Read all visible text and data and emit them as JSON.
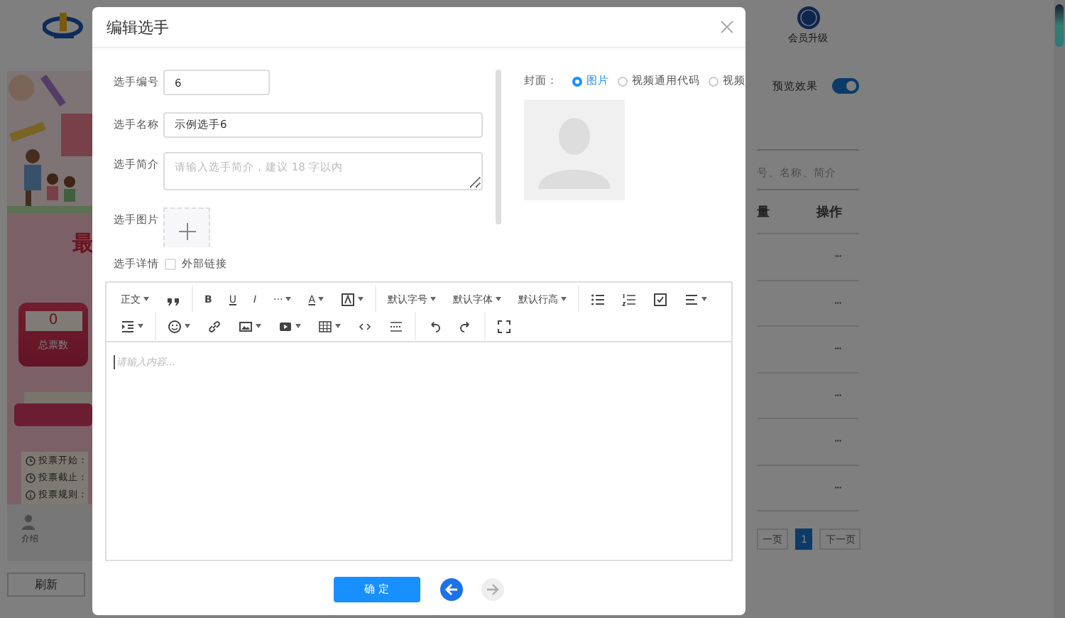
{
  "page": {
    "header": {
      "vip_label": "会员升级"
    },
    "preview": {
      "heading": "最",
      "total_votes": {
        "value": "0",
        "label": "总票数"
      },
      "info_rows": [
        {
          "kind": "clock",
          "label": "投票开始："
        },
        {
          "kind": "clock",
          "label": "投票截止："
        },
        {
          "kind": "info",
          "label": "投票规则："
        }
      ],
      "nav": [
        {
          "label": "介绍"
        }
      ],
      "refresh_button": "刷新"
    },
    "panel": {
      "preview_toggle": {
        "label": "预览效果",
        "on": true
      },
      "search": {
        "placeholder": "号、名称、简介"
      },
      "table": {
        "columns": [
          "量",
          "操作"
        ],
        "rows": [
          {
            "action": "···"
          },
          {
            "action": "···"
          },
          {
            "action": "···"
          },
          {
            "action": "···"
          },
          {
            "action": "···"
          },
          {
            "action": "···"
          }
        ]
      },
      "pagination": {
        "prev": "一页",
        "pages": [
          {
            "label": "1",
            "selected": true
          }
        ],
        "next": "下一页"
      }
    }
  },
  "dialog": {
    "title": "编辑选手",
    "fields": [
      {
        "kind": "input",
        "label": "选手编号",
        "value": "6"
      },
      {
        "kind": "input",
        "label": "选手名称",
        "value": "示例选手6"
      },
      {
        "kind": "textarea",
        "label": "选手简介",
        "placeholder": "请输入选手简介，建议 18 字以内"
      },
      {
        "kind": "upload",
        "label": "选手图片"
      },
      {
        "kind": "checkbox",
        "label": "选手详情",
        "option": "外部链接",
        "checked": false
      }
    ],
    "cover": {
      "label": "封面：",
      "options": [
        {
          "label": "图片",
          "selected": true
        },
        {
          "label": "视频通用代码",
          "selected": false
        },
        {
          "label": "视频",
          "selected": false
        }
      ]
    },
    "editor": {
      "toolbar": [
        [
          {
            "kind": "text",
            "label": "正文",
            "caret": true
          },
          {
            "kind": "icon",
            "caret": false
          },
          {
            "kind": "divider"
          },
          {
            "kind": "bold",
            "label": "B",
            "caret": false
          },
          {
            "kind": "underline",
            "label": "U",
            "caret": false
          },
          {
            "kind": "italic",
            "label": "I",
            "caret": false
          },
          {
            "kind": "text",
            "label": "···",
            "caret": true
          },
          {
            "kind": "underline",
            "label": "A",
            "caret": true
          },
          {
            "kind": "icon",
            "caret": true
          },
          {
            "kind": "divider"
          },
          {
            "kind": "text",
            "label": "默认字号",
            "caret": true
          },
          {
            "kind": "text",
            "label": "默认字体",
            "caret": true
          },
          {
            "kind": "text",
            "label": "默认行高",
            "caret": true
          },
          {
            "kind": "divider"
          },
          {
            "kind": "icon",
            "caret": false
          },
          {
            "kind": "icon",
            "caret": false
          },
          {
            "kind": "icon",
            "caret": false
          },
          {
            "kind": "icon",
            "caret": true
          }
        ],
        [
          {
            "kind": "icon",
            "caret": true
          },
          {
            "kind": "divider"
          },
          {
            "kind": "icon",
            "caret": true
          },
          {
            "kind": "icon",
            "caret": false
          },
          {
            "kind": "icon",
            "caret": true
          },
          {
            "kind": "icon",
            "caret": true
          },
          {
            "kind": "icon",
            "caret": true
          },
          {
            "kind": "icon",
            "caret": false
          },
          {
            "kind": "icon",
            "caret": false
          },
          {
            "kind": "divider"
          },
          {
            "kind": "icon",
            "caret": false
          },
          {
            "kind": "icon",
            "caret": false
          },
          {
            "kind": "divider"
          },
          {
            "kind": "icon",
            "caret": false
          }
        ]
      ],
      "placeholder": "请输入内容..."
    },
    "confirm_button": "确 定",
    "nav": [
      {
        "kind": "back",
        "disabled": false
      },
      {
        "kind": "forward",
        "disabled": true
      }
    ]
  }
}
